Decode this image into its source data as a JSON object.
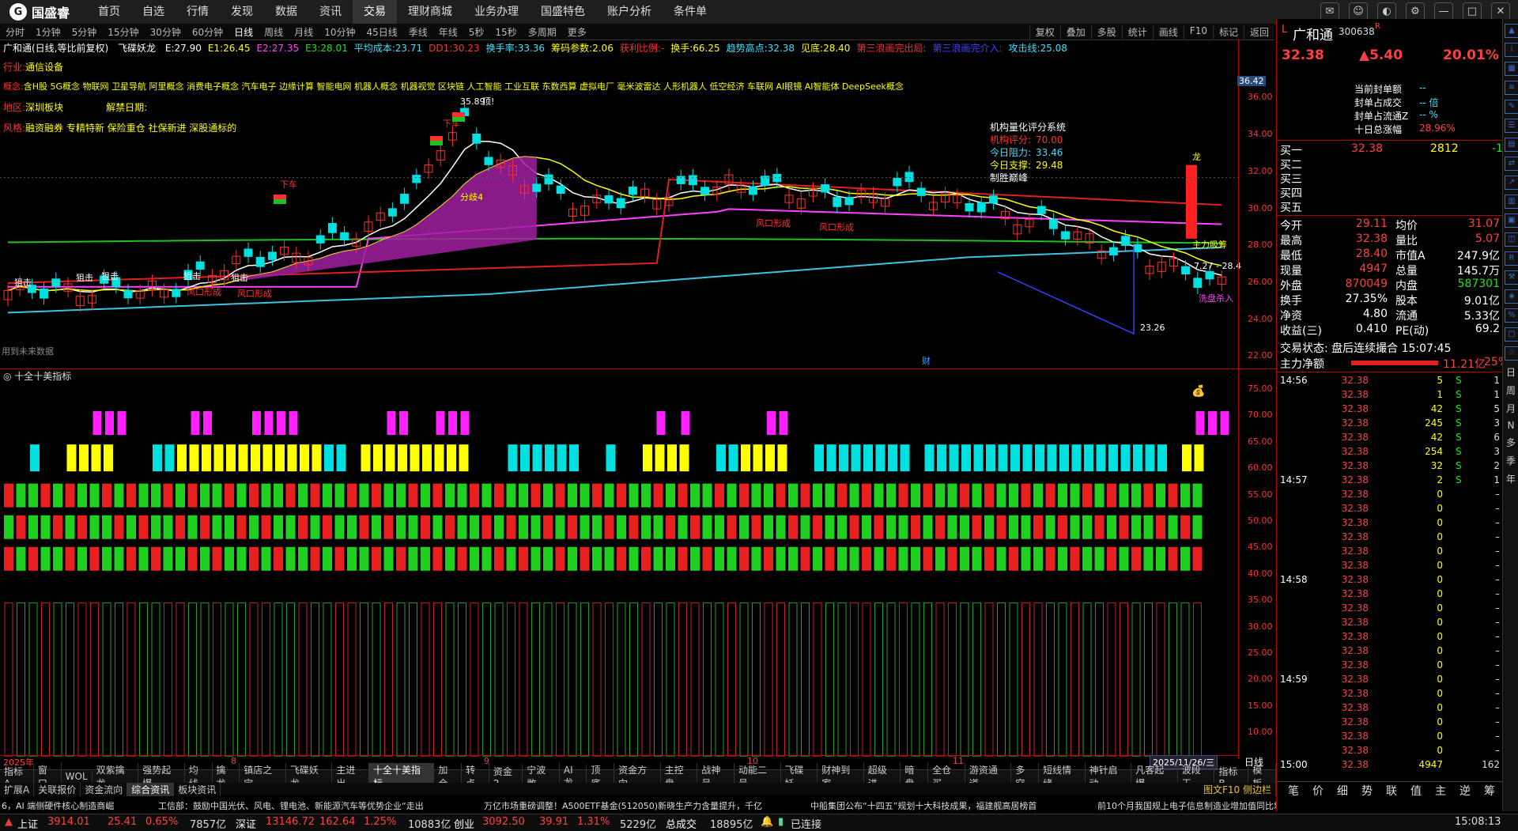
{
  "menubar": {
    "logo": "国盛睿",
    "items": [
      "首页",
      "自选",
      "行情",
      "发现",
      "数据",
      "资讯",
      "交易",
      "理财商城",
      "业务办理",
      "国盛特色",
      "账户分析",
      "条件单"
    ],
    "active_index": 6
  },
  "periods": {
    "items": [
      "分时",
      "1分钟",
      "5分钟",
      "15分钟",
      "30分钟",
      "60分钟",
      "日线",
      "周线",
      "月线",
      "10分钟",
      "45日线",
      "季线",
      "年线",
      "5秒",
      "15秒",
      "多周期",
      "更多"
    ],
    "active_index": 6,
    "tools": [
      "复权",
      "叠加",
      "多股",
      "统计",
      "画线",
      "F10",
      "标记",
      "返回"
    ]
  },
  "chart_header": {
    "name": "广和通(日线,等比前复权)",
    "indicator": "飞碟妖龙",
    "kv": [
      {
        "k": "E:",
        "v": "27.90",
        "c": "#ffffff"
      },
      {
        "k": "E1:",
        "v": "26.45",
        "c": "#ffff00"
      },
      {
        "k": "E2:",
        "v": "27.35",
        "c": "#ff40ff"
      },
      {
        "k": "E3:",
        "v": "28.01",
        "c": "#20e020"
      },
      {
        "k": "平均成本:",
        "v": "23.71",
        "c": "#40e0ff"
      },
      {
        "k": "DD1:",
        "v": "30.23",
        "c": "#ff3030"
      },
      {
        "k": "换手率:",
        "v": "33.36",
        "c": "#40e0ff"
      },
      {
        "k": "筹码参数:",
        "v": "2.06",
        "c": "#ffff00"
      },
      {
        "k": "获利比例:",
        "v": "-",
        "c": "#ff3030"
      },
      {
        "k": "换手:",
        "v": "66.25",
        "c": "#ffff00"
      },
      {
        "k": "趋势高点:",
        "v": "32.38",
        "c": "#40e0ff"
      },
      {
        "k": "见底:",
        "v": "28.40",
        "c": "#ffff00"
      },
      {
        "k": "第三浪画完出局:",
        "v": "",
        "c": "#ff3030"
      },
      {
        "k": "第三浪画完介入:",
        "v": "",
        "c": "#4040ff"
      },
      {
        "k": "攻击线:",
        "v": "25.08",
        "c": "#40e0ff"
      }
    ]
  },
  "stock_info": {
    "industry_label": "行业:",
    "industry": "通信设备",
    "concept_label": "概念:",
    "concepts": "含H股 5G概念 物联网 卫星导航 阿里概念 消费电子概念 汽车电子 边缘计算 智能电网 机器人概念 机器视觉 区块链 人工智能 工业互联 东数西算 虚拟电厂 毫米波雷达 人形机器人 低空经济 车联网 AI眼镜 AI智能体 DeepSeek概念",
    "region_label": "地区:",
    "region": "深圳板块",
    "unlock_label": "解禁日期:",
    "style_label": "风格:",
    "style": "融资融券 专精特新 保险重仓 社保新进 深股通标的"
  },
  "quant_box": {
    "title": "机构量化评分系统",
    "score_label": "机构评分:",
    "score": "70.00",
    "pressure_label": "今日阻力:",
    "pressure": "33.46",
    "support_label": "今日支撑:",
    "support": "29.48",
    "result": "制胜巅峰"
  },
  "annotations": {
    "sell_labels": [
      "下车",
      "下车"
    ],
    "snipe": "狙击",
    "fengkou": "风口形成",
    "fenqi": "分歧4",
    "high_label": "35.89",
    "high_mark": "顶!",
    "low_label": "23.26",
    "zhuli": "主力吸筹",
    "range_label": "7.27 - 28.4",
    "xipan": "洗盘杀入",
    "cai": "财",
    "future_note": "用到未来数据",
    "long": "龙",
    "current_price_tag": "36.42"
  },
  "main_y_axis": [
    "36.00",
    "34.00",
    "32.00",
    "30.00",
    "28.00",
    "26.00",
    "24.00",
    "22.00"
  ],
  "sub_panel": {
    "title": "十全十美指标",
    "y_axis": [
      "75.00",
      "70.00",
      "65.00",
      "60.00",
      "55.00",
      "50.00",
      "45.00",
      "40.00",
      "35.00",
      "30.00",
      "25.00",
      "20.00",
      "15.00",
      "10.00"
    ]
  },
  "x_axis": {
    "labels": [
      "2025年",
      "8",
      "9",
      "10",
      "11"
    ],
    "current_date": "2025/11/26/三",
    "period": "日线"
  },
  "tabs": [
    "指标A",
    "窗口",
    "WOL",
    "双紫擒龙",
    "强势起爆",
    "均线",
    "擒龙",
    "镇店之宝",
    "飞碟妖龙",
    "主进出",
    "十全十美指标",
    "加仓",
    "转点",
    "资金2",
    "宁波敢",
    "AI龙",
    "顶底",
    "资金方向",
    "主控盘",
    "战神号",
    "动能二号",
    "飞碟妖",
    "财神到家",
    "超级进",
    "暗盘",
    "全仓买",
    "游资通道",
    "多空",
    "短线情绪",
    "神针启动",
    "凡客起爆",
    "波段王"
  ],
  "tabs_active_index": 10,
  "tabs_right": [
    "指标B",
    "模板"
  ],
  "tabs2": [
    "扩展A",
    "关联报价",
    "资金流向",
    "综合资讯",
    "板块资讯"
  ],
  "tabs2_active_index": 3,
  "tabs2_right": "图文F10 侧边栏",
  "news": [
    "6，AI 端侧硬件核心制造商崛",
    "工信部：鼓励中国光伏、风电、锂电池、新能源汽车等优势企业“走出",
    "万亿市场重磅调整！A500ETF基金(512050)新晓生产力含量提升，千亿",
    "中船集团公布“十四五”规划十大科技成果，福建舰高居榜首",
    "前10个月我国规上电子信息制造业增加值同比增长10.6%",
    "深圳证券交易所西藏服务基地揭牌"
  ],
  "status": {
    "sh_label": "上证",
    "sh": "3914.01",
    "sh_chg": "25.41",
    "sh_pct": "0.65%",
    "sh_amt": "7857亿",
    "sz_label": "深证",
    "sz": "13146.72",
    "sz_chg": "162.64",
    "sz_pct": "1.25%",
    "sz_amt": "10883亿",
    "cy_label": "创业",
    "cy": "3092.50",
    "cy_chg": "39.91",
    "cy_pct": "1.31%",
    "cy_amt": "5229亿",
    "total_label": "总成交",
    "total": "18895亿",
    "conn": "已连接",
    "time": "15:08:13"
  },
  "quote": {
    "name": "广和通",
    "code": "300638",
    "badge": "R",
    "price": "32.38",
    "change": "▲5.40",
    "pct": "20.01%",
    "limit_lines": [
      {
        "k": "当前封单额",
        "v": "--"
      },
      {
        "k": "封单占成交",
        "v": "-- 倍"
      },
      {
        "k": "封单占流通Z",
        "v": "-- %"
      },
      {
        "k": "十日总涨幅",
        "v": "28.96%"
      }
    ],
    "buy_levels": [
      {
        "k": "买一",
        "p": "32.38",
        "v": "2812",
        "d": "-1"
      },
      {
        "k": "买二",
        "p": "",
        "v": "",
        "d": ""
      },
      {
        "k": "买三",
        "p": "",
        "v": "",
        "d": ""
      },
      {
        "k": "买四",
        "p": "",
        "v": "",
        "d": ""
      },
      {
        "k": "买五",
        "p": "",
        "v": "",
        "d": ""
      }
    ],
    "stats": [
      {
        "k1": "今开",
        "v1": "29.11",
        "k2": "均价",
        "v2": "31.07"
      },
      {
        "k1": "最高",
        "v1": "32.38",
        "k2": "量比",
        "v2": "5.07"
      },
      {
        "k1": "最低",
        "v1": "28.40",
        "k2": "市值A",
        "v2": "247.9亿"
      },
      {
        "k1": "现量",
        "v1": "4947",
        "k2": "总量",
        "v2": "145.7万"
      },
      {
        "k1": "外盘",
        "v1": "870049",
        "k2": "内盘",
        "v2": "587301"
      },
      {
        "k1": "换手",
        "v1": "27.35%",
        "k2": "股本",
        "v2": "9.01亿"
      },
      {
        "k1": "净资",
        "v1": "4.80",
        "k2": "流通",
        "v2": "5.33亿"
      },
      {
        "k1": "收益(三)",
        "v1": "0.410",
        "k2": "PE(动)",
        "v2": "69.2"
      }
    ],
    "trade_state": "交易状态: 盘后连续撮合 15:07:45",
    "net_label": "主力净额",
    "net_value": "11.21亿",
    "net_pct": "25%",
    "ticks": [
      {
        "t": "14:56",
        "p": "32.38",
        "v": "5",
        "s": "S",
        "n": "1"
      },
      {
        "t": "",
        "p": "32.38",
        "v": "1",
        "s": "S",
        "n": "1"
      },
      {
        "t": "",
        "p": "32.38",
        "v": "42",
        "s": "S",
        "n": "5"
      },
      {
        "t": "",
        "p": "32.38",
        "v": "245",
        "s": "S",
        "n": "3"
      },
      {
        "t": "",
        "p": "32.38",
        "v": "42",
        "s": "S",
        "n": "6"
      },
      {
        "t": "",
        "p": "32.38",
        "v": "254",
        "s": "S",
        "n": "3"
      },
      {
        "t": "",
        "p": "32.38",
        "v": "32",
        "s": "S",
        "n": "2"
      },
      {
        "t": "14:57",
        "p": "32.38",
        "v": "2",
        "s": "S",
        "n": "1"
      },
      {
        "t": "",
        "p": "32.38",
        "v": "0",
        "s": "",
        "n": "–"
      },
      {
        "t": "",
        "p": "32.38",
        "v": "0",
        "s": "",
        "n": "–"
      },
      {
        "t": "",
        "p": "32.38",
        "v": "0",
        "s": "",
        "n": "–"
      },
      {
        "t": "",
        "p": "32.38",
        "v": "0",
        "s": "",
        "n": "–"
      },
      {
        "t": "",
        "p": "32.38",
        "v": "0",
        "s": "",
        "n": "–"
      },
      {
        "t": "",
        "p": "32.38",
        "v": "0",
        "s": "",
        "n": "–"
      },
      {
        "t": "14:58",
        "p": "32.38",
        "v": "0",
        "s": "",
        "n": "–"
      },
      {
        "t": "",
        "p": "32.38",
        "v": "0",
        "s": "",
        "n": "–"
      },
      {
        "t": "",
        "p": "32.38",
        "v": "0",
        "s": "",
        "n": "–"
      },
      {
        "t": "",
        "p": "32.38",
        "v": "0",
        "s": "",
        "n": "–"
      },
      {
        "t": "",
        "p": "32.38",
        "v": "0",
        "s": "",
        "n": "–"
      },
      {
        "t": "",
        "p": "32.38",
        "v": "0",
        "s": "",
        "n": "–"
      },
      {
        "t": "",
        "p": "32.38",
        "v": "0",
        "s": "",
        "n": "–"
      },
      {
        "t": "14:59",
        "p": "32.38",
        "v": "0",
        "s": "",
        "n": "–"
      },
      {
        "t": "",
        "p": "32.38",
        "v": "0",
        "s": "",
        "n": "–"
      },
      {
        "t": "",
        "p": "32.38",
        "v": "0",
        "s": "",
        "n": "–"
      },
      {
        "t": "",
        "p": "32.38",
        "v": "0",
        "s": "",
        "n": "–"
      },
      {
        "t": "",
        "p": "32.38",
        "v": "0",
        "s": "",
        "n": "–"
      },
      {
        "t": "",
        "p": "32.38",
        "v": "0",
        "s": "",
        "n": "–"
      },
      {
        "t": "15:00",
        "p": "32.38",
        "v": "4947",
        "s": "",
        "n": "162"
      }
    ],
    "bottom_tabs": [
      "笔",
      "价",
      "细",
      "势",
      "联",
      "值",
      "主",
      "逆",
      "筹"
    ]
  },
  "side_chars": [
    "日",
    "周",
    "月",
    "N",
    "多",
    "季",
    "年"
  ],
  "colors": {
    "up": "#ff3030",
    "down": "#00e0e0",
    "accent": "#ffff00",
    "ma_white": "#ffffff",
    "ma_yellow": "#ffff00",
    "ma_mag": "#ff40ff",
    "ma_green": "#20c020",
    "ma_red": "#e02020",
    "ma_cyan": "#40c0e0"
  }
}
